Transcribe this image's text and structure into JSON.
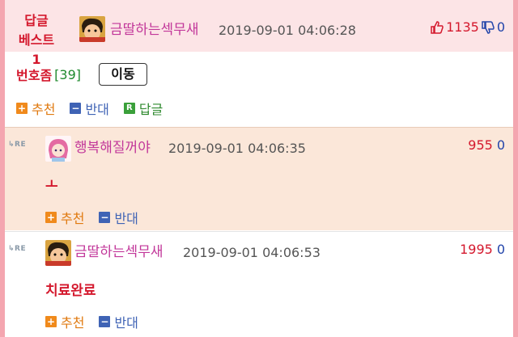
{
  "best_comment": {
    "tag_line1": "답글",
    "tag_line2": "베스트1",
    "author": "금딸하는섹무새",
    "date": "2019-09-01 04:06:28",
    "upvotes": "1135",
    "downvotes": "0",
    "number_label": "번호좀",
    "number_count": "[39]",
    "move_button": "이동",
    "recommend_label": "추천",
    "oppose_label": "반대",
    "reply_label": "답글"
  },
  "replies": [
    {
      "author": "행복해질꺼야",
      "date": "2019-09-01 04:06:35",
      "votes": "955",
      "votes_down": "0",
      "body": "ㅗ",
      "recommend_label": "추천",
      "oppose_label": "반대"
    },
    {
      "author": "금딸하는섹무새",
      "date": "2019-09-01 04:06:53",
      "votes": "1995",
      "votes_down": "0",
      "body": "치료완료",
      "recommend_label": "추천",
      "oppose_label": "반대"
    }
  ],
  "icons": {
    "re": "RE",
    "plus": "+",
    "minus": "−",
    "r": "R"
  },
  "colors": {
    "accent_red": "#d4182d",
    "author_pink": "#c2379a",
    "best_bg": "#fce4e6",
    "reply_highlight_bg": "#fbe7d9"
  }
}
